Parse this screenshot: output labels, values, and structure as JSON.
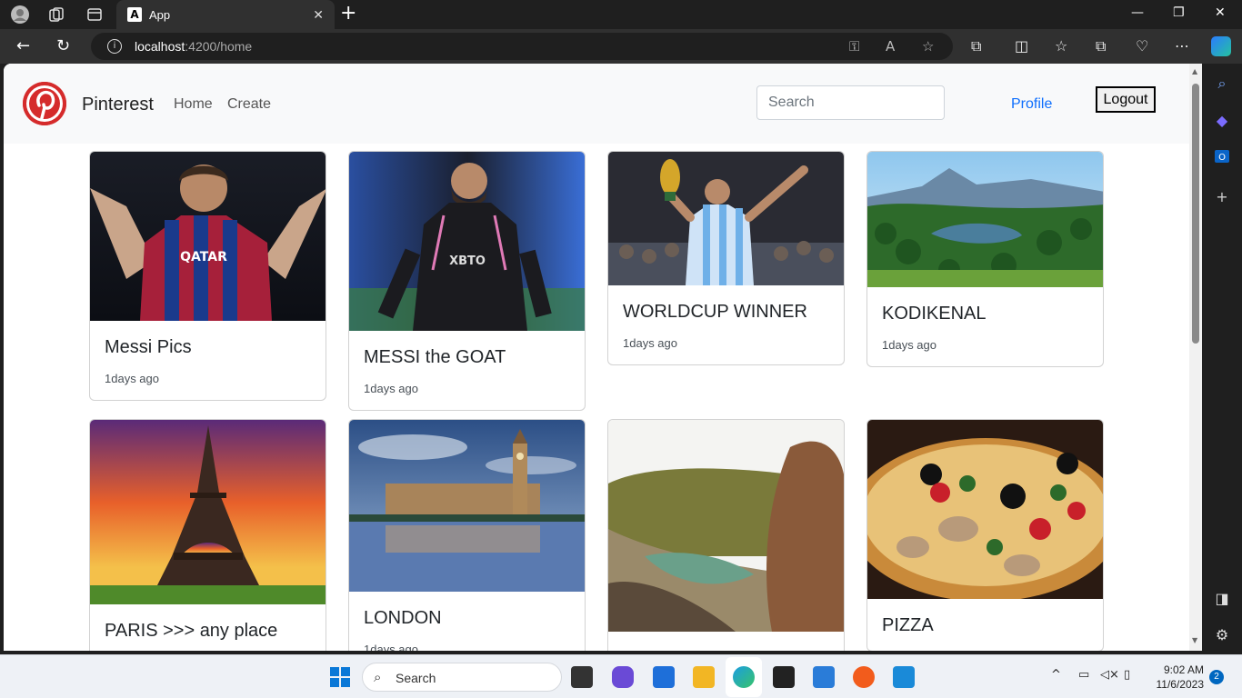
{
  "browser": {
    "tab_title": "App",
    "tab_favicon": "A",
    "url_host": "localhost",
    "url_rest": ":4200/home"
  },
  "app": {
    "brand": "Pinterest",
    "nav": [
      "Home",
      "Create"
    ],
    "search_placeholder": "Search",
    "profile_label": "Profile",
    "logout_label": "Logout",
    "accent_color": "#d52b2b",
    "link_color": "#0d6efd"
  },
  "cards": [
    {
      "title": "Messi Pics",
      "date": "1days ago",
      "image": "soccer-player-red-blue-kit"
    },
    {
      "title": "MESSI the GOAT",
      "date": "1days ago",
      "image": "soccer-player-black-kit"
    },
    {
      "title": "WORLDCUP WINNER",
      "date": "1days ago",
      "image": "player-holding-trophy"
    },
    {
      "title": "KODIKENAL",
      "date": "1days ago",
      "image": "green-valley-lake"
    },
    {
      "title": "PARIS >>> any place",
      "date": "",
      "image": "eiffel-tower-sunset"
    },
    {
      "title": "LONDON",
      "date": "1days ago",
      "image": "london-parliament-river"
    },
    {
      "title": "",
      "date": "",
      "image": "rocky-beach-cove"
    },
    {
      "title": "PIZZA",
      "date": "",
      "image": "pizza-olives"
    }
  ],
  "taskbar": {
    "search_label": "Search",
    "time": "9:02 AM",
    "date": "11/6/2023",
    "notifications": "2"
  }
}
